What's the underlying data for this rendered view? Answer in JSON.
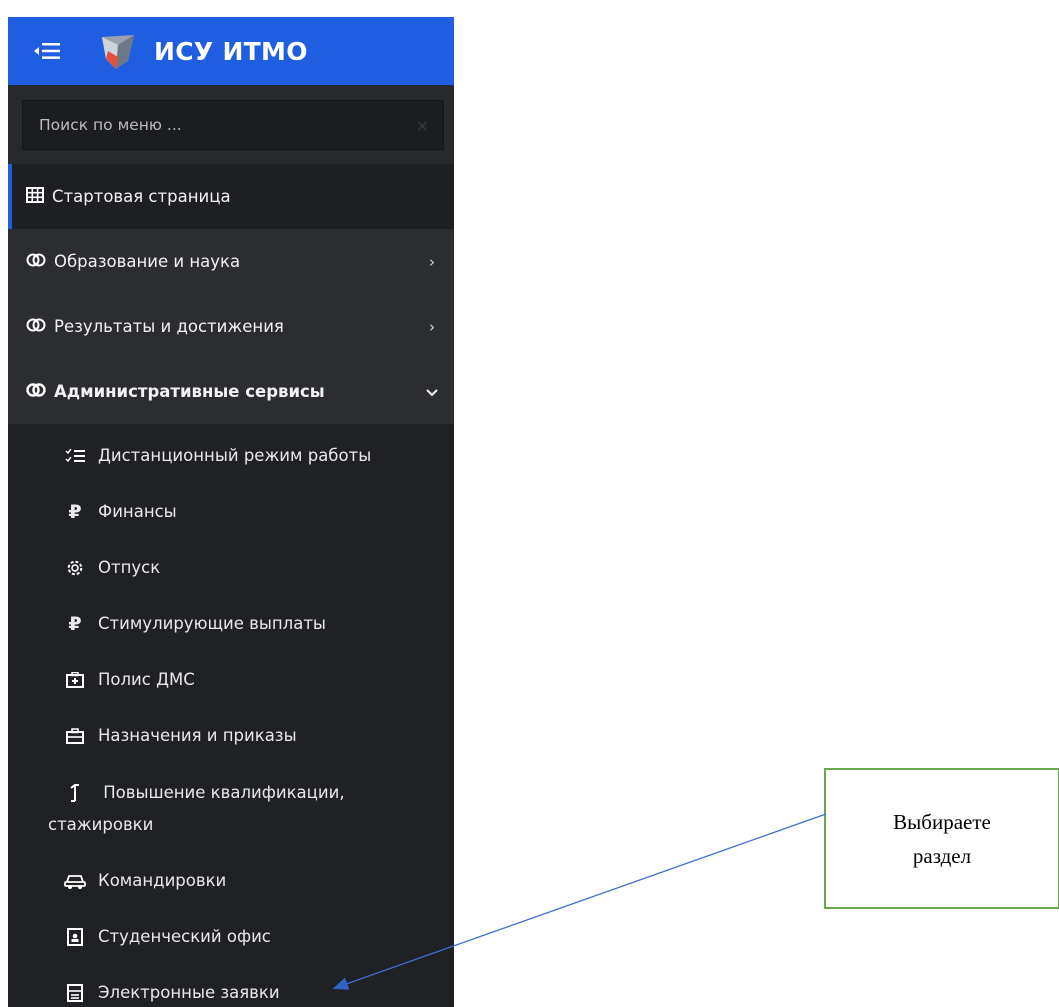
{
  "header": {
    "toggle_icon": "collapse-menu-icon",
    "logo_icon": "itmo-shield-logo",
    "title": "ИСУ ИТМО",
    "accent": "#1f5ee0"
  },
  "search": {
    "placeholder": "Поиск по меню ...",
    "value": "",
    "clear": "×"
  },
  "menu": [
    {
      "label": "Стартовая страница",
      "icon": "grid-icon",
      "active": true
    },
    {
      "label": "Образование и наука",
      "icon": "toggle-circles-icon",
      "chevron": "›"
    },
    {
      "label": "Результаты и достижения",
      "icon": "toggle-circles-icon",
      "chevron": "›"
    },
    {
      "label": "Административные сервисы",
      "icon": "toggle-circles-icon",
      "chevron": "⌄",
      "expanded": true
    }
  ],
  "submenu": [
    {
      "label": "Дистанционный режим работы",
      "icon": "checklist-icon"
    },
    {
      "label": "Финансы",
      "icon": "ruble-icon"
    },
    {
      "label": "Отпуск",
      "icon": "gear-icon"
    },
    {
      "label": "Стимулирующие выплаты",
      "icon": "ruble-icon"
    },
    {
      "label": "Полис ДМС",
      "icon": "medical-box-icon"
    },
    {
      "label": "Назначения и приказы",
      "icon": "briefcase-icon"
    },
    {
      "label": "Повышение квалификации,",
      "label2": "стажировки",
      "icon": "arrow-up-icon"
    },
    {
      "label": "Командировки",
      "icon": "car-icon"
    },
    {
      "label": "Студенческий офис",
      "icon": "document-person-icon"
    },
    {
      "label": "Электронные заявки",
      "icon": "form-icon"
    }
  ],
  "callout": {
    "line1": "Выбираете",
    "line2": "раздел"
  }
}
